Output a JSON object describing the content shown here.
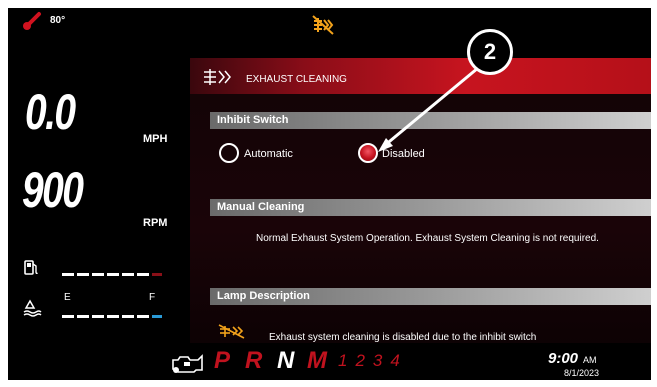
{
  "status": {
    "temperature": "80°"
  },
  "gauges": {
    "speed": {
      "value": "0.0",
      "unit": "MPH"
    },
    "rpm": {
      "value": "900",
      "unit": "RPM"
    },
    "def": {
      "empty_label": "E",
      "full_label": "F"
    }
  },
  "header": {
    "title": "EXHAUST CLEANING"
  },
  "inhibit_switch": {
    "title": "Inhibit Switch",
    "options": [
      {
        "label": "Automatic",
        "selected": false
      },
      {
        "label": "Disabled",
        "selected": true
      }
    ]
  },
  "manual_cleaning": {
    "title": "Manual Cleaning",
    "text": "Normal Exhaust System Operation. Exhaust System Cleaning is not required."
  },
  "lamp_description": {
    "title": "Lamp Description",
    "text": "Exhaust system cleaning is disabled due to the inhibit switch"
  },
  "callout": {
    "number": "2"
  },
  "transmission": {
    "gears": [
      "P",
      "R",
      "N",
      "M"
    ],
    "active_gear": "N",
    "manual_gears": "1234"
  },
  "clock": {
    "time": "9:00",
    "ampm": "AM",
    "date": "8/1/2023"
  },
  "colors": {
    "accent_red": "#c7141f",
    "warning_orange": "#f2a21b",
    "def_blue": "#2a9ad6"
  }
}
